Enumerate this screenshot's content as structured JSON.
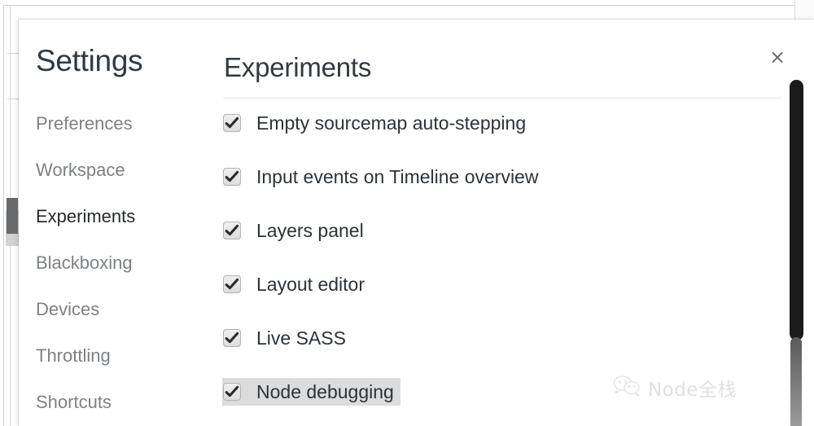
{
  "window": {
    "close_label": "×"
  },
  "sidebar": {
    "title": "Settings",
    "items": [
      {
        "label": "Preferences",
        "selected": false
      },
      {
        "label": "Workspace",
        "selected": false
      },
      {
        "label": "Experiments",
        "selected": true
      },
      {
        "label": "Blackboxing",
        "selected": false
      },
      {
        "label": "Devices",
        "selected": false
      },
      {
        "label": "Throttling",
        "selected": false
      },
      {
        "label": "Shortcuts",
        "selected": false
      }
    ]
  },
  "content": {
    "title": "Experiments",
    "experiments": [
      {
        "label": "Empty sourcemap auto-stepping",
        "checked": true,
        "highlighted": false
      },
      {
        "label": "Input events on Timeline overview",
        "checked": true,
        "highlighted": false
      },
      {
        "label": "Layers panel",
        "checked": true,
        "highlighted": false
      },
      {
        "label": "Layout editor",
        "checked": true,
        "highlighted": false
      },
      {
        "label": "Live SASS",
        "checked": true,
        "highlighted": false
      },
      {
        "label": "Node debugging",
        "checked": true,
        "highlighted": true
      }
    ]
  },
  "watermark": {
    "text": "Node全栈",
    "icon": "wechat-logo"
  },
  "colors": {
    "dialog_bg": "#ffffff",
    "sidebar_text": "#7e8184",
    "sidebar_text_selected": "#26292c",
    "selection_marker": "#67696b",
    "highlight_bg": "#dcdcdc",
    "scrollbar_thumb": "#1b1b1b",
    "rule": "#e4e4e4"
  }
}
